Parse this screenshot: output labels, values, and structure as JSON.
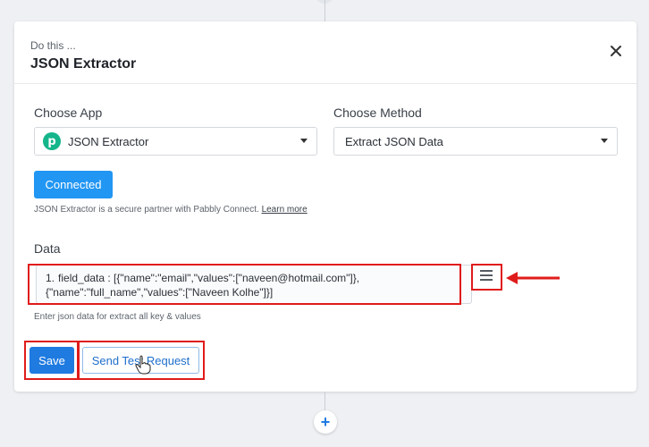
{
  "header": {
    "kicker": "Do this ...",
    "title": "JSON Extractor"
  },
  "choose_app": {
    "label": "Choose App",
    "value": "JSON Extractor",
    "logo_letter": "p"
  },
  "choose_method": {
    "label": "Choose Method",
    "value": "Extract JSON Data"
  },
  "connection": {
    "button_label": "Connected",
    "note": "JSON Extractor is a secure partner with Pabbly Connect.",
    "learn_more": "Learn more"
  },
  "data_field": {
    "label": "Data",
    "index": "1.",
    "line1": "field_data : [{\"name\":\"email\",\"values\":[\"naveen@hotmail.com\"]},",
    "line2": "{\"name\":\"full_name\",\"values\":[\"Naveen Kolhe\"]}]",
    "helper": "Enter json data for extract all key & values"
  },
  "actions": {
    "save_label": "Save",
    "test_label": "Send Test Request"
  },
  "colors": {
    "primary": "#2196f3",
    "save": "#1f7be0",
    "highlight": "#e01b1b",
    "logo": "#15b58a"
  },
  "icons": [
    "close-icon",
    "chevron-down-icon",
    "menu-icon",
    "arrow-icon",
    "hand-cursor-icon",
    "plus-icon"
  ]
}
